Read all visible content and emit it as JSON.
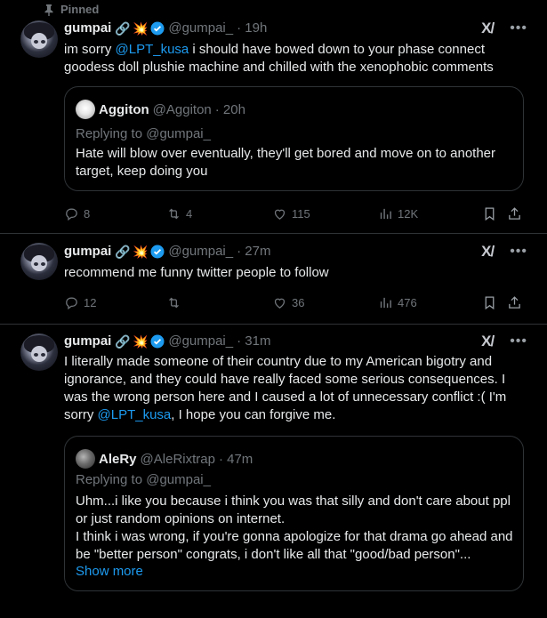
{
  "pinned_label": "Pinned",
  "tweets": [
    {
      "name": "gumpai",
      "emoji1": "🔗",
      "emoji2": "💥",
      "handle": "@gumpai_",
      "time": "· 19h",
      "text_a": "im sorry ",
      "mention": "@LPT_kusa",
      "text_b": "  i should have bowed down to your phase connect goodess doll plushie machine and chilled with the xenophobic comments",
      "quote": {
        "name": "Aggiton",
        "handle": "@Aggiton",
        "time": "· 20h",
        "replying": "Replying to @gumpai_",
        "text": "Hate will blow over eventually, they'll get bored and move on to another target, keep doing you"
      },
      "replies": "8",
      "retweets": "4",
      "likes": "115",
      "views": "12K"
    },
    {
      "name": "gumpai",
      "emoji1": "🔗",
      "emoji2": "💥",
      "handle": "@gumpai_",
      "time": "· 27m",
      "text": "recommend me funny twitter people to follow",
      "replies": "12",
      "retweets": "",
      "likes": "36",
      "views": "476"
    },
    {
      "name": "gumpai",
      "emoji1": "🔗",
      "emoji2": "💥",
      "handle": "@gumpai_",
      "time": "· 31m",
      "text_a": "I literally made someone of their country due to my American bigotry and ignorance, and they could have really faced some serious consequences. I was the wrong person here and I caused a lot of unnecessary conflict :( I'm sorry ",
      "mention": "@LPT_kusa",
      "text_b": ", I hope you can forgive me.",
      "quote": {
        "name": "AleRy",
        "handle": "@AleRixtrap",
        "time": "· 47m",
        "replying": "Replying to @gumpai_",
        "text1": "Uhm...i like you because i think you was that silly and don't care about ppl or just random opinions on internet.",
        "text2": "I think i was wrong, if you're gonna apologize for that drama go ahead and be \"better person\" congrats, i don't like all that \"good/bad person\"...",
        "show_more": "Show more"
      }
    }
  ],
  "colors": {
    "accent": "#1d9bf0",
    "muted": "#71767b",
    "border": "#2f3336",
    "background": "#000000",
    "text": "#e7e9ea"
  },
  "icons": [
    "pin-icon",
    "verified-badge-icon",
    "grok-icon",
    "more-icon",
    "reply-icon",
    "retweet-icon",
    "like-icon",
    "views-icon",
    "bookmark-icon",
    "share-icon"
  ]
}
